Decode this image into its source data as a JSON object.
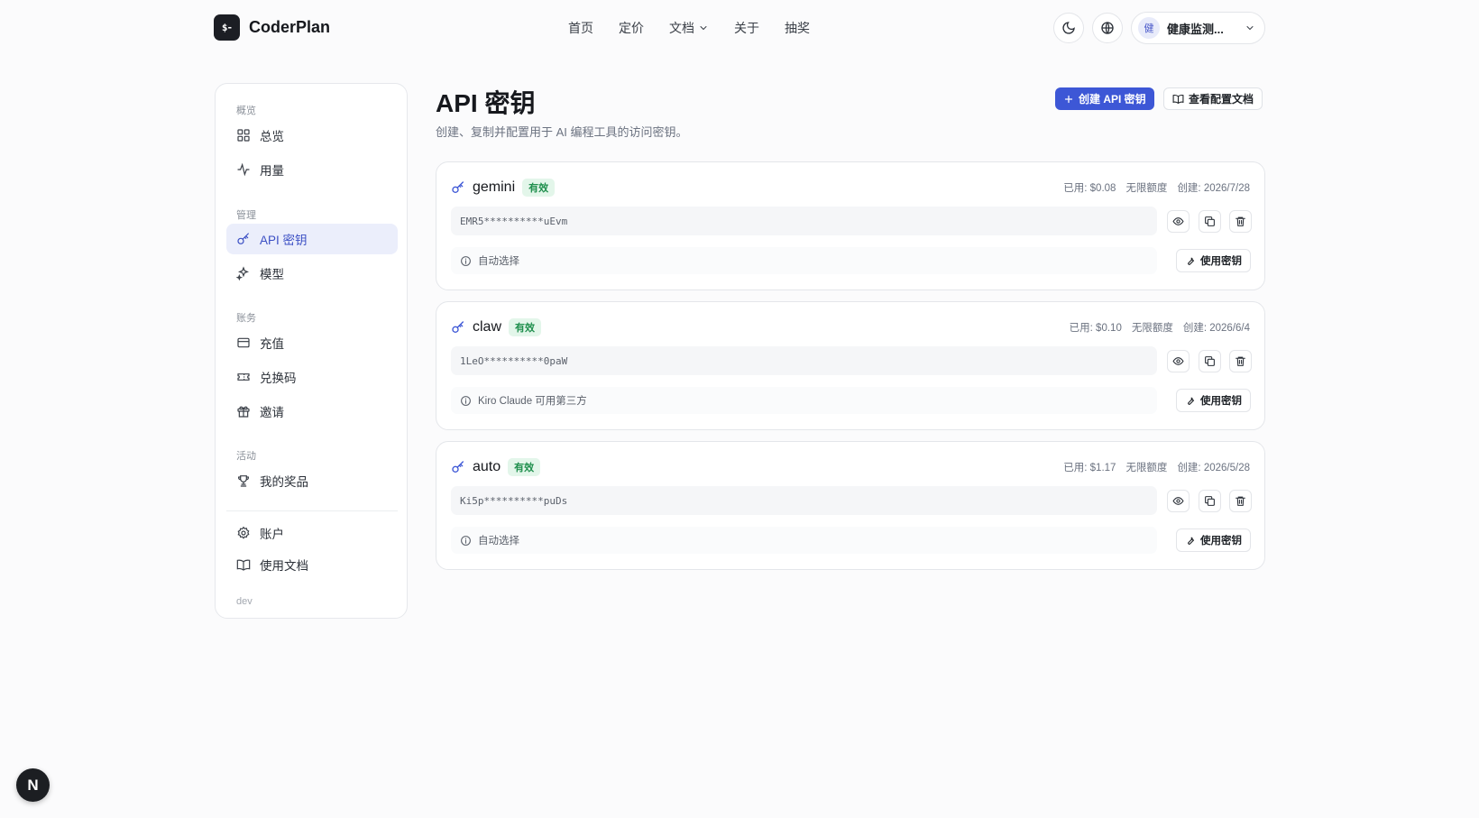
{
  "header": {
    "logo_mark": "$-",
    "brand": "CoderPlan",
    "nav": [
      {
        "label": "首页"
      },
      {
        "label": "定价"
      },
      {
        "label": "文档"
      },
      {
        "label": "关于"
      },
      {
        "label": "抽奖"
      }
    ],
    "user": {
      "avatar": "健",
      "name": "健康监测..."
    }
  },
  "sidebar": {
    "groups": [
      "概览",
      "管理",
      "账务",
      "活动"
    ],
    "items": [
      {
        "label": "总览",
        "icon": "grid-icon"
      },
      {
        "label": "用量",
        "icon": "activity-icon"
      },
      {
        "label": "API 密钥",
        "icon": "key-icon",
        "active": true
      },
      {
        "label": "模型",
        "icon": "sparkles-icon"
      },
      {
        "label": "充值",
        "icon": "credit-card-icon"
      },
      {
        "label": "兑换码",
        "icon": "ticket-icon"
      },
      {
        "label": "邀请",
        "icon": "gift-icon"
      },
      {
        "label": "我的奖品",
        "icon": "trophy-icon"
      },
      {
        "label": "账户",
        "icon": "gear-icon"
      },
      {
        "label": "使用文档",
        "icon": "book-icon"
      }
    ],
    "footer": "dev"
  },
  "main": {
    "title": "API 密钥",
    "subtitle": "创建、复制并配置用于 AI 编程工具的访问密钥。",
    "create_button": "创建 API 密钥",
    "docs_button": "查看配置文档",
    "keys": [
      {
        "name": "gemini",
        "status": "有效",
        "used": "已用: $0.08",
        "quota": "无限额度",
        "created": "创建: 2026/7/28",
        "masked_key": "EMR5**********uEvm",
        "note": "自动选择",
        "use_label": "使用密钥"
      },
      {
        "name": "claw",
        "status": "有效",
        "used": "已用: $0.10",
        "quota": "无限额度",
        "created": "创建: 2026/6/4",
        "masked_key": "1LeO**********0paW",
        "note": "Kiro Claude 可用第三方",
        "use_label": "使用密钥"
      },
      {
        "name": "auto",
        "status": "有效",
        "used": "已用: $1.17",
        "quota": "无限额度",
        "created": "创建: 2026/5/28",
        "masked_key": "Ki5p**********puDs",
        "note": "自动选择",
        "use_label": "使用密钥"
      }
    ]
  },
  "dev_badge": "N",
  "colors": {
    "accent": "#3d57d6",
    "active_bg": "#ebeefb",
    "status_green": "#1f8f4d"
  }
}
